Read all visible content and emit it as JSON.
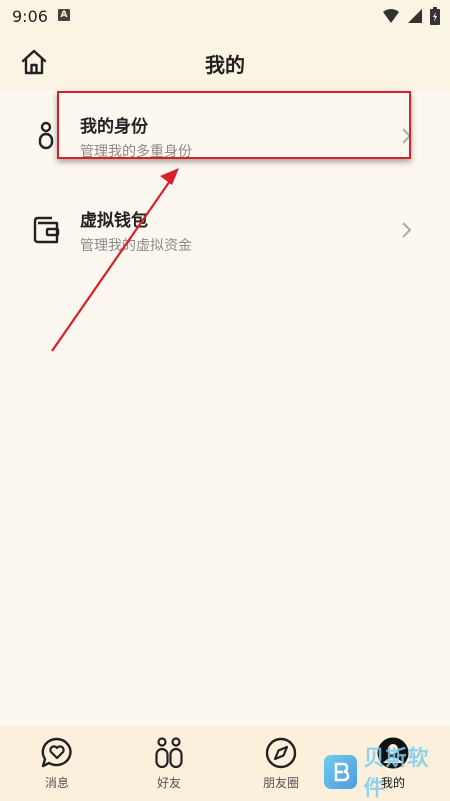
{
  "status_bar": {
    "time": "9:06",
    "notification_badge": "A",
    "icons": [
      "wifi-icon",
      "signal-icon",
      "battery-icon"
    ]
  },
  "header": {
    "title": "我的",
    "home_icon": "home-icon"
  },
  "menu": [
    {
      "title": "我的身份",
      "subtitle": "管理我的多重身份",
      "icon": "person-icon",
      "highlighted": true
    },
    {
      "title": "虚拟钱包",
      "subtitle": "管理我的虚拟资金",
      "icon": "wallet-icon",
      "highlighted": false
    }
  ],
  "bottom_nav": [
    {
      "label": "消息",
      "icon": "chat-bubble-heart-icon",
      "active": false
    },
    {
      "label": "好友",
      "icon": "friends-icon",
      "active": false
    },
    {
      "label": "朋友圈",
      "icon": "compass-icon",
      "active": false
    },
    {
      "label": "我的",
      "icon": "profile-icon",
      "active": true
    }
  ],
  "watermark": {
    "text": "贝斯软件",
    "logo_letter": "B"
  },
  "colors": {
    "background": "#fdf8ef",
    "bar": "#fbf3e3",
    "nav": "#fbf0dc",
    "annotation": "#d8202a"
  }
}
